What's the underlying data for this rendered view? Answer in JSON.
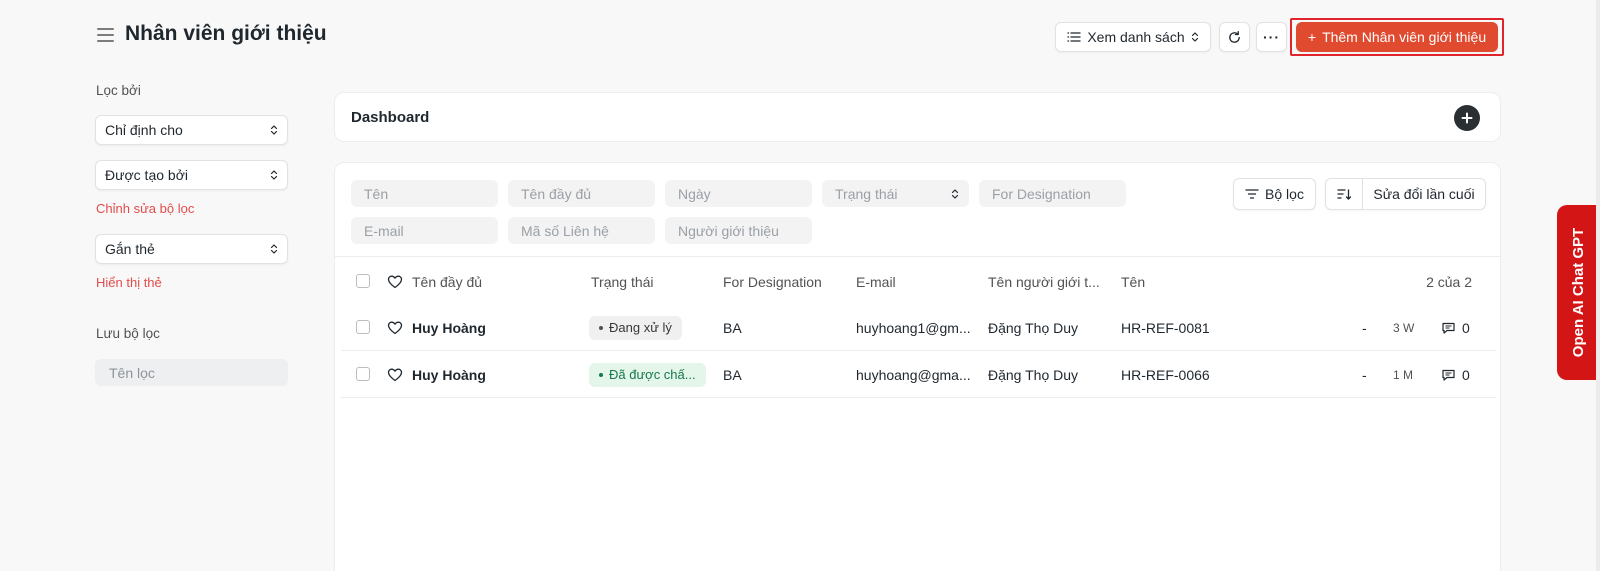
{
  "header": {
    "title": "Nhân viên giới thiệu",
    "view_label": "Xem danh sách",
    "more_label": "···",
    "add_label": "Thêm Nhân viên giới thiệu",
    "add_prefix": "+"
  },
  "sidebar": {
    "filter_by_label": "Lọc bởi",
    "assigned_to": "Chỉ định cho",
    "created_by": "Được tạo bởi",
    "edit_filters": "Chỉnh sửa bộ lọc",
    "tags": "Gắn thẻ",
    "show_tags": "Hiển thị thẻ",
    "save_filter_label": "Lưu bộ lọc",
    "filter_name_placeholder": "Tên lọc"
  },
  "dashboard": {
    "title": "Dashboard"
  },
  "filters": {
    "name": "Tên",
    "full_name": "Tên đầy đủ",
    "date": "Ngày",
    "status": "Trạng thái",
    "for_designation": "For Designation",
    "email": "E-mail",
    "contact_no": "Mã số Liên hệ",
    "referrer": "Người giới thiệu",
    "filter_button": "Bộ lọc",
    "sort_label": "Sửa đổi lần cuối"
  },
  "table": {
    "columns": {
      "full_name": "Tên đầy đủ",
      "status": "Trạng thái",
      "designation": "For Designation",
      "email": "E-mail",
      "referrer": "Tên người giới t...",
      "name": "Tên",
      "count": "2 của 2"
    },
    "rows": [
      {
        "full_name": "Huy Hoàng",
        "status": "Đang xử lý",
        "designation": "BA",
        "email": "huyhoang1@gm...",
        "referrer": "Đặng Thọ Duy",
        "name": "HR-REF-0081",
        "dash": "-",
        "age": "3 W",
        "comments": "0"
      },
      {
        "full_name": "Huy Hoàng",
        "status": "Đã được chấ...",
        "designation": "BA",
        "email": "huyhoang@gma...",
        "referrer": "Đặng Thọ Duy",
        "name": "HR-REF-0066",
        "dash": "-",
        "age": "1 M",
        "comments": "0"
      }
    ]
  },
  "side_tab": {
    "label": "Open AI Chat GPT"
  },
  "colors": {
    "primary": "#e04a2f",
    "link": "#e24c4c",
    "side_tab": "#d31515"
  }
}
